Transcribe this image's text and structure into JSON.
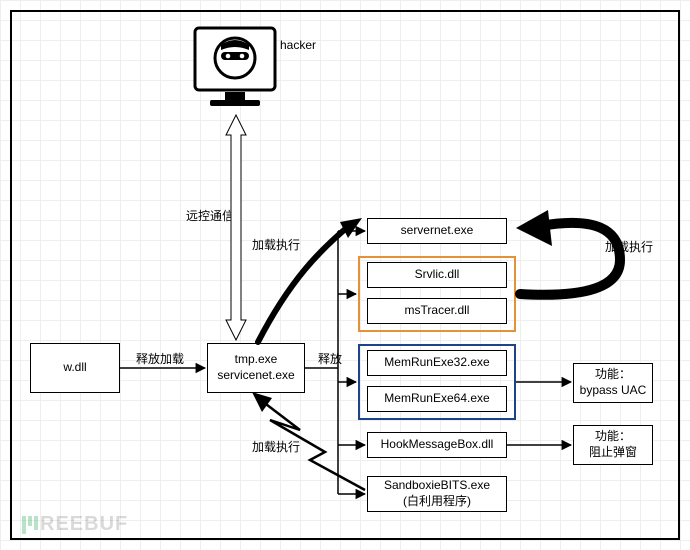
{
  "hacker_label": "hacker",
  "edges": {
    "remote_ctrl": "远控通信",
    "release_load": "释放加载",
    "load_exec_top": "加载执行",
    "load_exec_right": "加载执行",
    "load_exec_bottom": "加载执行",
    "release": "释放",
    "func_bypass": "功能：\nbypass UAC",
    "func_block": "功能：\n阻止弹窗"
  },
  "nodes": {
    "wdll": "w.dll",
    "tmpexe_line1": "tmp.exe",
    "tmpexe_line2": "servicenet.exe",
    "servernet": "servernet.exe",
    "srvlic": "Srvlic.dll",
    "mstracer": "msTracer.dll",
    "memrun32": "MemRunExe32.exe",
    "memrun64": "MemRunExe64.exe",
    "hookmsgbox": "HookMessageBox.dll",
    "sandboxie_line1": "SandboxieBITS.exe",
    "sandboxie_line2": "(白利用程序)"
  },
  "watermark": "REEBUF"
}
